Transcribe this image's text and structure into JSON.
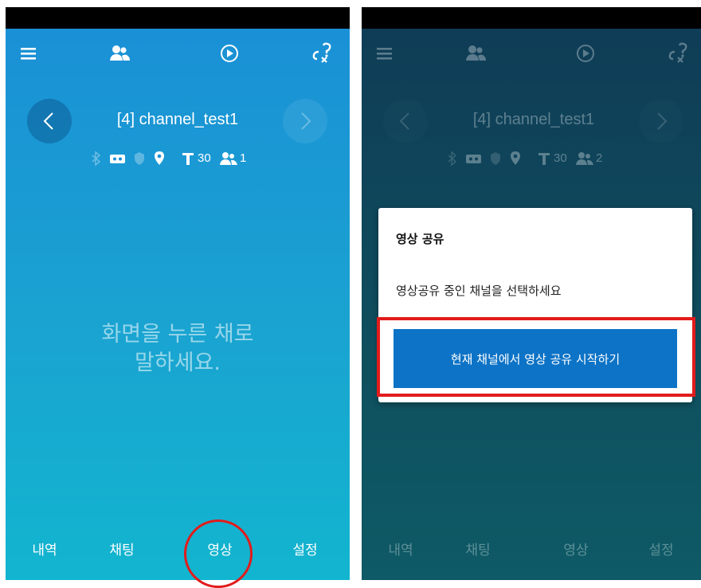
{
  "colors": {
    "accent_blue": "#1a8fd6",
    "dialog_button": "#0d73c6",
    "highlight_red": "#e21b1b"
  },
  "left_screen": {
    "toolbar": {
      "icons": [
        "menu-icon",
        "users-icon",
        "play-icon",
        "unlink-icon"
      ]
    },
    "channel_title": "[4] channel_test1",
    "status": {
      "icons": [
        "bluetooth-icon",
        "battery-icon",
        "shield-icon",
        "location-icon",
        "text-size-icon",
        "users-icon"
      ],
      "text_size_value": "30",
      "user_count": "1"
    },
    "hint_line1": "화면을 누른 채로",
    "hint_line2": "말하세요.",
    "bottom_nav": [
      "내역",
      "채팅",
      "영상",
      "설정"
    ]
  },
  "right_screen": {
    "channel_title": "[4] channel_test1",
    "status": {
      "text_size_value": "30",
      "user_count": "2"
    },
    "dialog": {
      "title": "영상 공유",
      "message": "영상공유 중인 채널을 선택하세요",
      "button_label": "현재 채널에서 영상 공유 시작하기"
    },
    "bottom_nav": [
      "내역",
      "채팅",
      "영상",
      "설정"
    ]
  }
}
